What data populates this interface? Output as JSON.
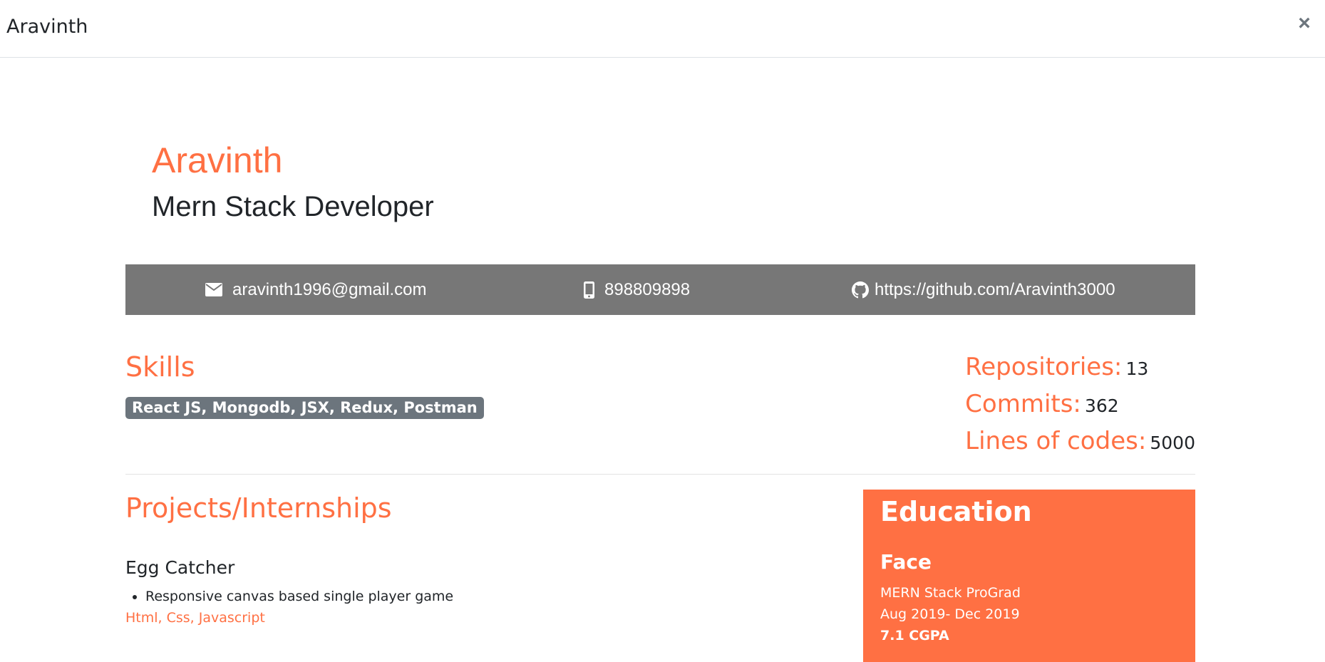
{
  "header": {
    "title": "Aravinth",
    "close_label": "×"
  },
  "profile": {
    "name": "Aravinth",
    "role": "Mern Stack Developer"
  },
  "contact": {
    "email": "aravinth1996@gmail.com",
    "phone": "898809898",
    "github": "https://github.com/Aravinth3000"
  },
  "skills": {
    "title": "Skills",
    "badge": "React JS, Mongodb, JSX, Redux, Postman"
  },
  "stats": [
    {
      "label": "Repositories:",
      "value": "13"
    },
    {
      "label": "Commits:",
      "value": "362"
    },
    {
      "label": "Lines of codes:",
      "value": "5000"
    }
  ],
  "projects": {
    "title": "Projects/Internships",
    "items": [
      {
        "name": "Egg Catcher",
        "bullets": [
          "Responsive canvas based single player game"
        ],
        "tech": "Html, Css, Javascript"
      }
    ]
  },
  "education": {
    "title": "Education",
    "school": "Face",
    "program": "MERN Stack ProGrad",
    "dates": "Aug 2019- Dec 2019",
    "grade": "7.1 CGPA"
  },
  "colors": {
    "accent": "#ff7043",
    "contact_bar": "#777777",
    "badge": "#6c757d"
  },
  "icons": {
    "email": "envelope-icon",
    "phone": "mobile-phone-icon",
    "github": "github-icon"
  }
}
